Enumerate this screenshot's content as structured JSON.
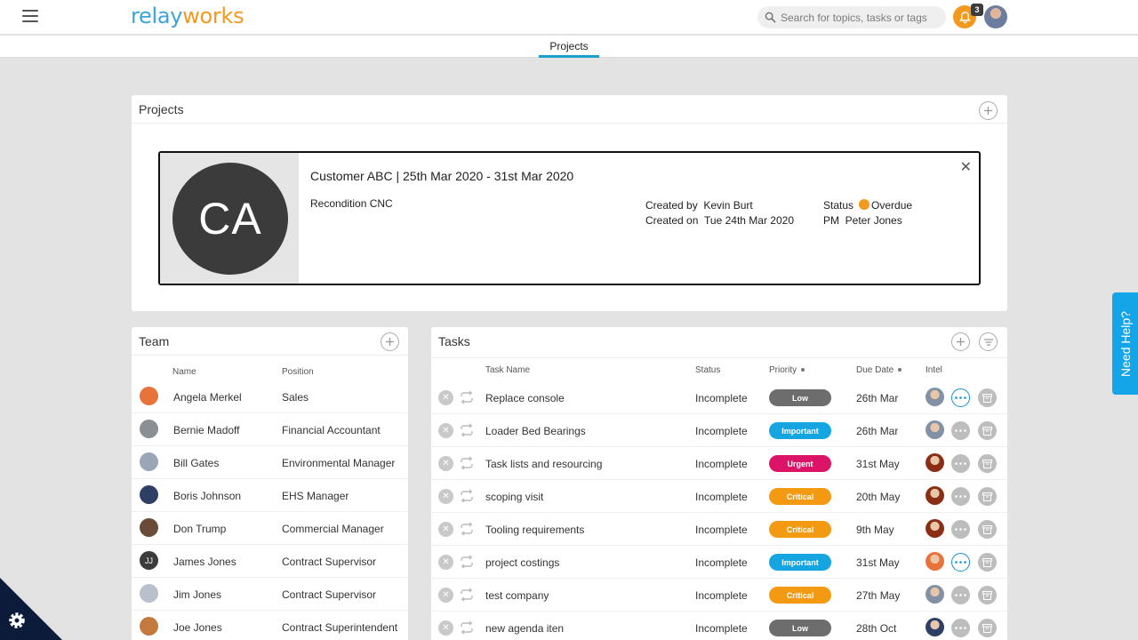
{
  "header": {
    "logo_part1": "relay",
    "logo_part2": "works",
    "search_placeholder": "Search for topics, tasks or tags",
    "notification_count": "3"
  },
  "subnav": {
    "active_tab": "Projects"
  },
  "projects": {
    "title": "Projects",
    "project": {
      "initials": "CA",
      "title": "Customer ABC | 25th Mar 2020 - 31st Mar 2020",
      "subtitle": "Recondition CNC",
      "created_by_label": "Created by",
      "created_by": "Kevin Burt",
      "created_on_label": "Created on",
      "created_on": "Tue 24th Mar 2020",
      "status_label": "Status",
      "status": "Overdue",
      "pm_label": "PM",
      "pm": "Peter Jones"
    }
  },
  "team": {
    "title": "Team",
    "col_name": "Name",
    "col_position": "Position",
    "members": [
      {
        "name": "Angela Merkel",
        "position": "Sales",
        "avatar_color": "#e8733a",
        "initials": ""
      },
      {
        "name": "Bernie Madoff",
        "position": "Financial Accountant",
        "avatar_color": "#8a8f94",
        "initials": ""
      },
      {
        "name": "Bill Gates",
        "position": "Environmental Manager",
        "avatar_color": "#9aa5b8",
        "initials": ""
      },
      {
        "name": "Boris Johnson",
        "position": "EHS Manager",
        "avatar_color": "#2e3f66",
        "initials": ""
      },
      {
        "name": "Don Trump",
        "position": "Commercial Manager",
        "avatar_color": "#6a4b3a",
        "initials": ""
      },
      {
        "name": "James Jones",
        "position": "Contract Supervisor",
        "avatar_color": "#3b3b3b",
        "initials": "JJ"
      },
      {
        "name": "Jim Jones",
        "position": "Contract Supervisor",
        "avatar_color": "#b8c0cc",
        "initials": ""
      },
      {
        "name": "Joe Jones",
        "position": "Contract Superintendent",
        "avatar_color": "#c47a3f",
        "initials": ""
      }
    ]
  },
  "tasks": {
    "title": "Tasks",
    "col_task_name": "Task Name",
    "col_status": "Status",
    "col_priority": "Priority",
    "col_due_date": "Due Date",
    "col_intel": "Intel",
    "rows": [
      {
        "name": "Replace console",
        "status": "Incomplete",
        "priority": "Low",
        "priority_color": "#6d6d6d",
        "due": "26th Mar",
        "intel_color": "#8391a6",
        "more_active": true
      },
      {
        "name": "Loader Bed Bearings",
        "status": "Incomplete",
        "priority": "Important",
        "priority_color": "#15a6e2",
        "due": "26th Mar",
        "intel_color": "#8391a6",
        "more_active": false
      },
      {
        "name": "Task lists and resourcing",
        "status": "Incomplete",
        "priority": "Urgent",
        "priority_color": "#dc1467",
        "due": "31st May",
        "intel_color": "#8b2e16",
        "more_active": false
      },
      {
        "name": "scoping visit",
        "status": "Incomplete",
        "priority": "Critical",
        "priority_color": "#f39a12",
        "due": "20th May",
        "intel_color": "#8b2e16",
        "more_active": false
      },
      {
        "name": "Tooling requirements",
        "status": "Incomplete",
        "priority": "Critical",
        "priority_color": "#f39a12",
        "due": "9th May",
        "intel_color": "#8b2e16",
        "more_active": false
      },
      {
        "name": "project costings",
        "status": "Incomplete",
        "priority": "Important",
        "priority_color": "#15a6e2",
        "due": "31st May",
        "intel_color": "#e8733a",
        "more_active": true
      },
      {
        "name": "test company",
        "status": "Incomplete",
        "priority": "Critical",
        "priority_color": "#f39a12",
        "due": "27th May",
        "intel_color": "#8391a6",
        "more_active": false
      },
      {
        "name": "new agenda iten",
        "status": "Incomplete",
        "priority": "Low",
        "priority_color": "#6d6d6d",
        "due": "28th Oct",
        "intel_color": "#2e3f66",
        "more_active": false
      }
    ]
  },
  "help": {
    "label": "Need Help?"
  }
}
